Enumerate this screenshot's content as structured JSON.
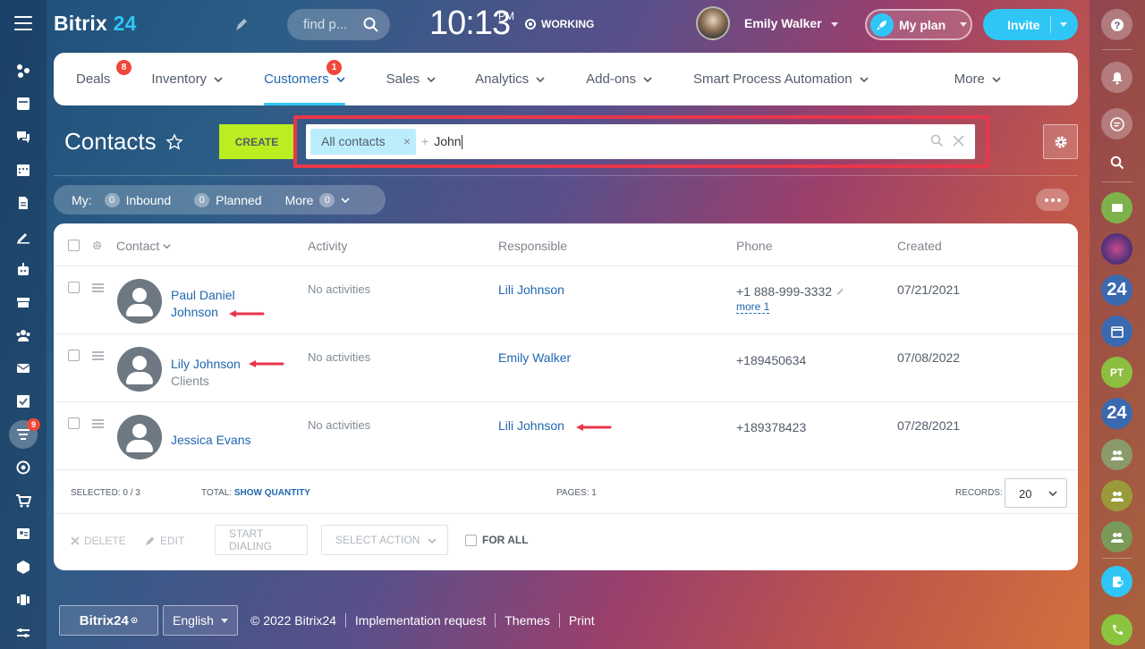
{
  "app": {
    "logo_text": "Bitrix",
    "logo_num": "24"
  },
  "header": {
    "search_placeholder": "find p...",
    "time": "10:13",
    "time_suffix": "PM",
    "status": "WORKING",
    "user_name": "Emily Walker",
    "plan_label": "My plan",
    "invite_label": "Invite"
  },
  "tabs": [
    {
      "label": "Deals",
      "badge": "8"
    },
    {
      "label": "Inventory"
    },
    {
      "label": "Customers",
      "badge": "1",
      "active": true
    },
    {
      "label": "Sales"
    },
    {
      "label": "Analytics"
    },
    {
      "label": "Add-ons"
    },
    {
      "label": "Smart Process Automation"
    },
    {
      "label": "More"
    }
  ],
  "page": {
    "title": "Contacts",
    "create_label": "CREATE",
    "filter_chip": "All contacts",
    "filter_chip_remove": "×",
    "filter_plus": "+",
    "filter_query": "John"
  },
  "counters": {
    "my_label": "My:",
    "inbound_count": "0",
    "inbound_label": "Inbound",
    "planned_count": "0",
    "planned_label": "Planned",
    "more_label": "More",
    "more_count": "0"
  },
  "grid": {
    "columns": {
      "contact": "Contact",
      "activity": "Activity",
      "responsible": "Responsible",
      "phone": "Phone",
      "created": "Created"
    },
    "rows": [
      {
        "name_line1": "Paul Daniel",
        "name_line2": "Johnson",
        "subtitle": "",
        "activity": "No activities",
        "responsible": "Lili Johnson",
        "phone": "+1 888-999-3332",
        "phone_more": "more 1",
        "created": "07/21/2021"
      },
      {
        "name_line1": "Lily Johnson",
        "name_line2": "",
        "subtitle": "Clients",
        "activity": "No activities",
        "responsible": "Emily Walker",
        "phone": "+189450634",
        "phone_more": "",
        "created": "07/08/2022"
      },
      {
        "name_line1": "Jessica Evans",
        "name_line2": "",
        "subtitle": "",
        "activity": "No activities",
        "responsible": "Lili Johnson",
        "phone": "+189378423",
        "phone_more": "",
        "created": "07/28/2021"
      }
    ],
    "footer": {
      "selected_label": "SELECTED: 0 / 3",
      "total_label": "TOTAL:",
      "total_link": "SHOW QUANTITY",
      "pages_label": "PAGES: 1",
      "records_label": "RECORDS:",
      "records_value": "20"
    },
    "actions": {
      "delete": "DELETE",
      "edit": "EDIT",
      "start_dialing": "START DIALING",
      "select_action": "SELECT ACTION",
      "for_all": "FOR ALL"
    }
  },
  "right_bar": {
    "badge_24": "24",
    "pt_initials": "PT"
  },
  "footer": {
    "brand": "Bitrix24",
    "language": "English",
    "copyright": "© 2022 Bitrix24",
    "implementation": "Implementation request",
    "themes": "Themes",
    "print": "Print"
  },
  "colors": {
    "accent": "#2fc6f6",
    "link": "#2067b0",
    "create": "#bbed21",
    "badge": "#f0483a",
    "highlight": "#e8364b"
  }
}
